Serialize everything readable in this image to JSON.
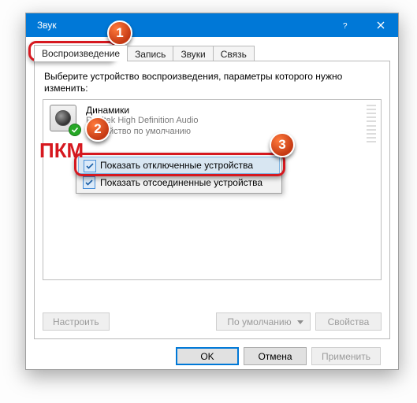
{
  "title": "Звук",
  "tabs": {
    "playback": "Воспроизведение",
    "recording": "Запись",
    "sounds": "Звуки",
    "comm": "Связь"
  },
  "prompt": "Выберите устройство воспроизведения, параметры которого нужно изменить:",
  "device": {
    "name": "Динамики",
    "driver": "Realtek High Definition Audio",
    "status": "Устройство по умолчанию"
  },
  "ctx": {
    "show_disabled": "Показать отключенные устройства",
    "show_disconnected": "Показать отсоединенные устройства"
  },
  "buttons": {
    "configure": "Настроить",
    "set_default": "По умолчанию",
    "properties": "Свойства",
    "ok": "OK",
    "cancel": "Отмена",
    "apply": "Применить"
  },
  "annot": {
    "pkm": "ПКМ"
  }
}
